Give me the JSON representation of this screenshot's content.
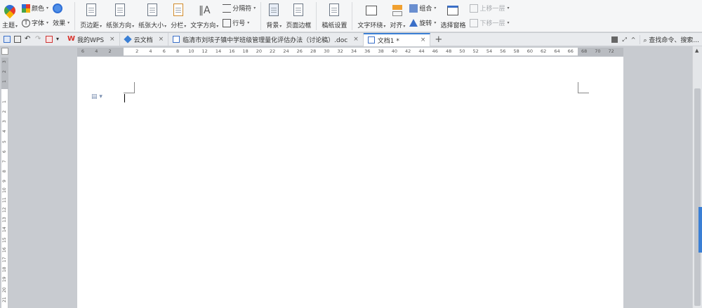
{
  "ribbon": {
    "theme": {
      "label": "主题"
    },
    "color": {
      "label": "颜色"
    },
    "font": {
      "label": "字体"
    },
    "effect": {
      "label": "效果"
    },
    "margins": {
      "label": "页边距"
    },
    "orientation": {
      "label": "纸张方向"
    },
    "size": {
      "label": "纸张大小"
    },
    "columns": {
      "label": "分栏"
    },
    "text_direction": {
      "label": "文字方向"
    },
    "breaks": {
      "label": "分隔符"
    },
    "line_numbers": {
      "label": "行号"
    },
    "background": {
      "label": "背景"
    },
    "page_border": {
      "label": "页面边框"
    },
    "manuscript": {
      "label": "稿纸设置"
    },
    "wrap_text": {
      "label": "文字环绕"
    },
    "align": {
      "label": "对齐"
    },
    "group": {
      "label": "组合"
    },
    "rotate": {
      "label": "旋转"
    },
    "selection_pane": {
      "label": "选择窗格"
    },
    "bring_forward": {
      "label": "上移一层"
    },
    "send_backward": {
      "label": "下移一层"
    }
  },
  "tabs": [
    {
      "label": "我的WPS",
      "close": "×"
    },
    {
      "label": "云文档",
      "close": "×"
    },
    {
      "label": "临清市刘垓子镇中学班级管理量化评估办法（讨论稿）.doc",
      "close": "×"
    },
    {
      "label": "文档1 *",
      "close": "×"
    }
  ],
  "new_tab": "+",
  "search": {
    "label": "查找命令、搜索..."
  },
  "ruler": {
    "h_ticks": [
      "6",
      "4",
      "2",
      "",
      "2",
      "4",
      "6",
      "8",
      "10",
      "12",
      "14",
      "16",
      "18",
      "20",
      "22",
      "24",
      "26",
      "28",
      "30",
      "32",
      "34",
      "36",
      "38",
      "40",
      "42",
      "44",
      "46",
      "48",
      "50",
      "52",
      "54",
      "56",
      "58",
      "60",
      "62",
      "64",
      "66",
      "68",
      "70",
      "72"
    ],
    "v_ticks": [
      "3",
      "2",
      "1",
      "",
      "1",
      "2",
      "3",
      "4",
      "5",
      "6",
      "7",
      "8",
      "9",
      "10",
      "11",
      "12",
      "13",
      "14",
      "15",
      "16",
      "17",
      "18",
      "19",
      "20",
      "21"
    ]
  },
  "colors": {
    "accent": "#3a7fd5",
    "wps_red": "#d9322b"
  }
}
